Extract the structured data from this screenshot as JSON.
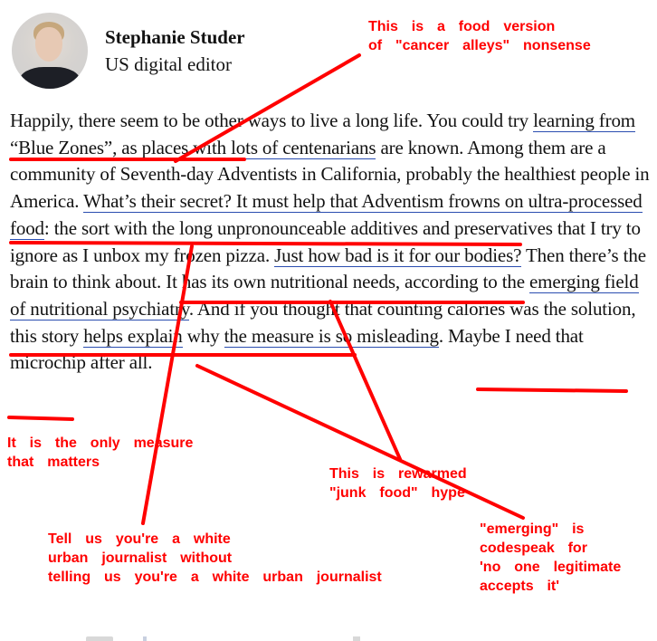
{
  "author": {
    "name": "Stephanie Studer",
    "role": "US digital editor",
    "avatar_icon": "author-portrait"
  },
  "article": {
    "segments": [
      {
        "text": "Happily, there seem to be other ways to live a long life. You could try ",
        "link": false
      },
      {
        "text": "learning from “Blue Zones”",
        "link": true
      },
      {
        "text": ", as ",
        "link": false
      },
      {
        "text": "places",
        "link": true
      },
      {
        "text": " with ",
        "link": false
      },
      {
        "text": "lots of centenarians",
        "link": true
      },
      {
        "text": " are known. Among them are a community of Seventh-day Adventists in California, probably the healthiest people in America. ",
        "link": false
      },
      {
        "text": "What’s their secret? It must help that Adventism frowns on ultra-processed food",
        "link": true
      },
      {
        "text": ": the sort with the long unpronounceable additives and preservatives that I try to ignore as I unbox my frozen pizza. ",
        "link": false
      },
      {
        "text": "Just how bad is it for our bodies?",
        "link": true
      },
      {
        "text": " Then there’s the brain to think about. It has its own nutritional needs, according to the ",
        "link": false
      },
      {
        "text": "emerging field of nutritional psychiatry",
        "link": true
      },
      {
        "text": ". And if you thought that counting calories was the solution, this story ",
        "link": false
      },
      {
        "text": "helps explain",
        "link": true
      },
      {
        "text": " why ",
        "link": false
      },
      {
        "text": "the measure is so misleading",
        "link": true
      },
      {
        "text": ". Maybe I need that microchip after all.",
        "link": false
      }
    ]
  },
  "annotations": {
    "color": "#ff0000",
    "cancer_alleys": "This  is  a  food  version\nof  \"cancer  alleys\"  nonsense",
    "only_measure": "It  is  the  only  measure\nthat  matters",
    "junk_food": "This  is  rewarmed\n\"junk  food\"  hype",
    "white_journalist": "Tell  us  you're  a  white\nurban  journalist  without\ntelling  us  you're  a  white  urban  journalist",
    "emerging": "\"emerging\"  is\ncodespeak  for\n'no  one  legitimate\naccepts  it'"
  },
  "colors": {
    "link_underline": "#2a4db0",
    "text": "#121212",
    "annotation": "#ff0000"
  }
}
